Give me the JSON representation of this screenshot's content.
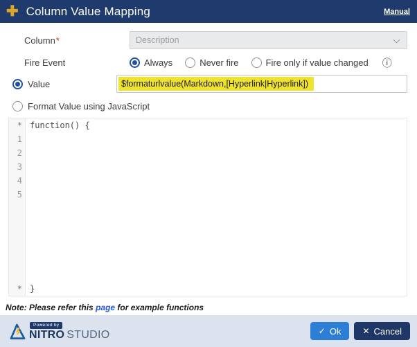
{
  "header": {
    "title": "Column Value Mapping",
    "manual_link": "Manual"
  },
  "form": {
    "column": {
      "label": "Column",
      "required": "*",
      "selected_value": "Description",
      "disabled": true
    },
    "fire_event": {
      "label": "Fire Event",
      "options": [
        {
          "label": "Always",
          "selected": true
        },
        {
          "label": "Never fire",
          "selected": false
        },
        {
          "label": "Fire only if value changed",
          "selected": false
        }
      ],
      "info_icon": "ⓘ"
    },
    "value": {
      "label": "Value",
      "selected": true,
      "input_value": "$formaturlvalue(Markdown,[Hyperlink|Hyperlink])"
    },
    "format_js": {
      "label": "Format Value using JavaScript",
      "selected": false
    }
  },
  "editor": {
    "first_line_marker": "*",
    "first_line_code": "function() {",
    "line_numbers": [
      "1",
      "2",
      "3",
      "4",
      "5"
    ],
    "last_line_marker": "*",
    "last_line_code": "}"
  },
  "note": {
    "prefix": "Note: Please refer this ",
    "link_text": "page",
    "suffix": " for example functions"
  },
  "footer": {
    "powered_by": "Powered by",
    "brand_primary": "NITRO",
    "brand_secondary": "STUDIO",
    "ok": {
      "icon": "✓",
      "label": "Ok"
    },
    "cancel": {
      "icon": "✕",
      "label": "Cancel"
    }
  },
  "colors": {
    "header_bg": "#1f3a6c",
    "plus_gold": "#d9a62b",
    "radio_blue": "#2050a0",
    "highlight_yellow": "#f0e32e",
    "ok_blue": "#2d7fd6",
    "cancel_navy": "#1e3766",
    "footer_bg": "#dde3ee"
  }
}
